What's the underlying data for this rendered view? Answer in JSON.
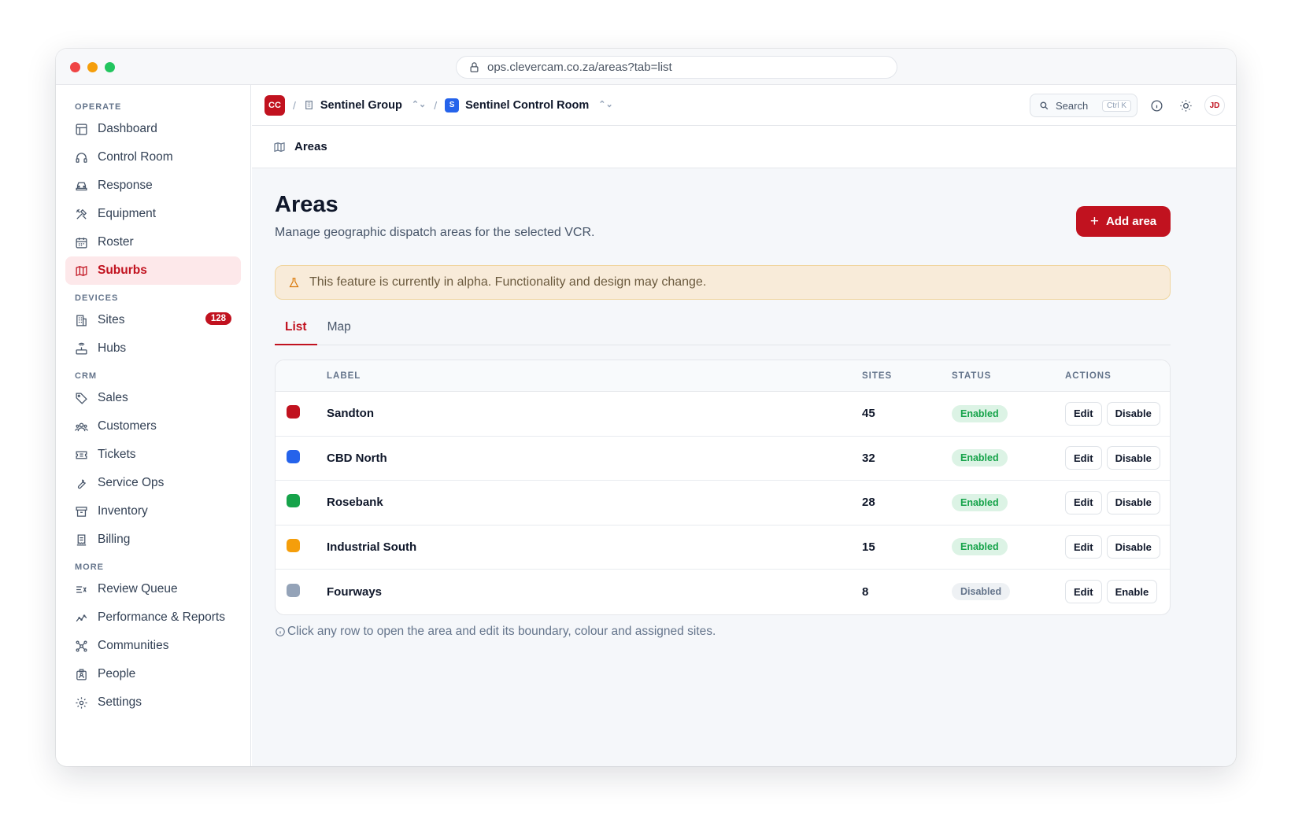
{
  "browser": {
    "url": "ops.clevercam.co.za/areas?tab=list"
  },
  "sidebar": {
    "sections": [
      {
        "label": "OPERATE",
        "items": [
          {
            "label": "Dashboard",
            "icon": "layout-icon"
          },
          {
            "label": "Control Room",
            "icon": "headset-icon"
          },
          {
            "label": "Response",
            "icon": "car-icon"
          },
          {
            "label": "Equipment",
            "icon": "tools-icon"
          },
          {
            "label": "Roster",
            "icon": "calendar-icon"
          },
          {
            "label": "Suburbs",
            "icon": "map-icon",
            "active": true
          }
        ]
      },
      {
        "label": "DEVICES",
        "items": [
          {
            "label": "Sites",
            "icon": "building-icon",
            "badge": "128"
          },
          {
            "label": "Hubs",
            "icon": "router-icon"
          }
        ]
      },
      {
        "label": "CRM",
        "items": [
          {
            "label": "Sales",
            "icon": "tag-icon"
          },
          {
            "label": "Customers",
            "icon": "users-icon"
          },
          {
            "label": "Tickets",
            "icon": "ticket-icon"
          },
          {
            "label": "Service Ops",
            "icon": "wrench-icon"
          },
          {
            "label": "Inventory",
            "icon": "archive-icon"
          },
          {
            "label": "Billing",
            "icon": "receipt-icon"
          }
        ]
      },
      {
        "label": "MORE",
        "items": [
          {
            "label": "Review Queue",
            "icon": "list-check-icon"
          },
          {
            "label": "Performance & Reports",
            "icon": "chart-line-icon"
          },
          {
            "label": "Communities",
            "icon": "network-icon"
          },
          {
            "label": "People",
            "icon": "id-badge-icon"
          },
          {
            "label": "Settings",
            "icon": "gear-icon"
          }
        ]
      }
    ]
  },
  "topbar": {
    "org_logo": "CC",
    "org_name": "Sentinel Group",
    "room_logo": "S",
    "room_name": "Sentinel Control Room",
    "search_label": "Search",
    "search_shortcut": "Ctrl K",
    "avatar": "JD"
  },
  "pagebar": {
    "title": "Areas"
  },
  "page": {
    "title": "Areas",
    "subtitle": "Manage geographic dispatch areas for the selected VCR.",
    "add_button": "Add area",
    "alert": "This feature is currently in alpha. Functionality and design may change.",
    "tabs": [
      {
        "label": "List",
        "active": true
      },
      {
        "label": "Map",
        "active": false
      }
    ],
    "table": {
      "columns": {
        "label": "LABEL",
        "sites": "SITES",
        "status": "STATUS",
        "actions": "ACTIONS"
      },
      "rows": [
        {
          "color": "#c1121f",
          "label": "Sandton",
          "sites": "45",
          "status": "Enabled",
          "edit": "Edit",
          "toggle": "Disable"
        },
        {
          "color": "#2563eb",
          "label": "CBD North",
          "sites": "32",
          "status": "Enabled",
          "edit": "Edit",
          "toggle": "Disable"
        },
        {
          "color": "#16a34a",
          "label": "Rosebank",
          "sites": "28",
          "status": "Enabled",
          "edit": "Edit",
          "toggle": "Disable"
        },
        {
          "color": "#f59e0b",
          "label": "Industrial South",
          "sites": "15",
          "status": "Enabled",
          "edit": "Edit",
          "toggle": "Disable"
        },
        {
          "color": "#94a3b8",
          "label": "Fourways",
          "sites": "8",
          "status": "Disabled",
          "edit": "Edit",
          "toggle": "Enable"
        }
      ]
    },
    "hint": "Click any row to open the area and edit its boundary, colour and assigned sites."
  },
  "colors": {
    "brand": "#c1121f",
    "accent_blue": "#2563eb",
    "enabled": "#16a34a"
  }
}
